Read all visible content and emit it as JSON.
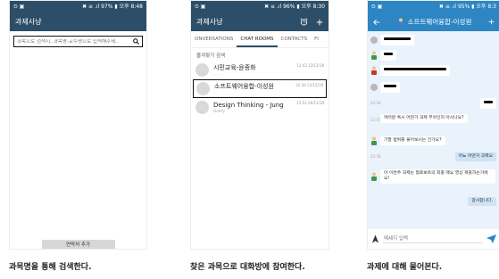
{
  "phone1": {
    "status": {
      "left": "⏲ ▣",
      "right": "✖ ≡ .ıl 97% ▮ 오후 8:48"
    },
    "title": "과제사냥",
    "search": {
      "placeholder": "과목으로 검색시, 과목명-교수명으로 입력해주세.."
    },
    "add_button": "연락처 추가",
    "caption": "과목명을 통해 검색한다."
  },
  "phone2": {
    "status": {
      "left": "⏲ ▣",
      "right": "✖ ≡ .ıl 96% ▮ 오후 8:30"
    },
    "title": "과제사냥",
    "tabs": [
      "ONVERSATIONS",
      "CHAT ROOMS",
      "CONTACTS",
      "FI"
    ],
    "subheader": "즐겨찾기 검색",
    "rooms": [
      {
        "title": "시민교육-윤종화",
        "sub": "· · · ·",
        "time": "12:43 12/12/18"
      },
      {
        "title": "소프트웨어융합-이성원",
        "sub": "· ·",
        "time": "22:39 12/12/18"
      },
      {
        "title": "Design Thinking - Jung",
        "sub": "Ddddy",
        "time": "23:52 06/12/18"
      }
    ],
    "caption": "찾은 과목으로 대화방에 참여한다."
  },
  "phone3": {
    "status": {
      "left": "⏲ ▣",
      "right": "✖ ≡ .ıl 95% ▮ 오후 8:3"
    },
    "title": "소프트웨어융합-이성원",
    "times": [
      "22:56",
      "22:57",
      "22:58"
    ],
    "messages": [
      "여러분 혹시 어떤거 과제 무엇인지 아시나요?",
      "기말 범위를 물어보시는 건가요?",
      "아뇨 어떤거 과제요",
      "아 이번주 과제는 협로보트의 회중 매요 영상 제출하는거에요!",
      "감사합니다."
    ],
    "composer_placeholder": "메세지 입력",
    "caption": "과제에 대해 물어본다."
  }
}
